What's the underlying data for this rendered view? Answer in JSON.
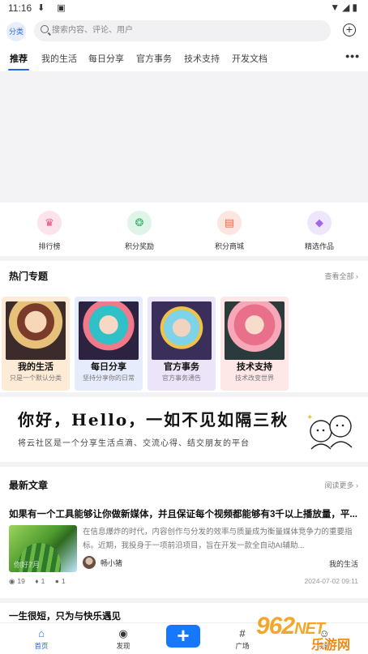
{
  "status_bar": {
    "time": "11:16",
    "left_icons": "⬇ ▣",
    "right_icons": "▼◢▮"
  },
  "header": {
    "category_label": "分类",
    "search_placeholder": "搜索内容、评论、用户"
  },
  "tabs": [
    "推荐",
    "我的生活",
    "每日分享",
    "官方事务",
    "技术支持",
    "开发文档"
  ],
  "more_label": "•••",
  "quick_links": [
    {
      "label": "排行榜",
      "icon": "crown-icon",
      "glyph": "♛",
      "bg": "#fde3ec",
      "fg": "#e94f86"
    },
    {
      "label": "积分奖励",
      "icon": "coin-icon",
      "glyph": "❂",
      "bg": "#dff5e8",
      "fg": "#34b26b"
    },
    {
      "label": "积分商城",
      "icon": "shop-icon",
      "glyph": "▤",
      "bg": "#fde6e2",
      "fg": "#ee6a56"
    },
    {
      "label": "精选作品",
      "icon": "gem-icon",
      "glyph": "◆",
      "bg": "#efe6fb",
      "fg": "#a368e8"
    }
  ],
  "topics": {
    "title": "热门专题",
    "more": "查看全部 ›",
    "items": [
      {
        "name": "我的生活",
        "desc": "只是一个默认分类",
        "bg": "#fdebd6"
      },
      {
        "name": "每日分享",
        "desc": "坚持分享你的日常",
        "bg": "#e6ecfb"
      },
      {
        "name": "官方事务",
        "desc": "官方事务通告",
        "bg": "#ece5f9"
      },
      {
        "name": "技术支持",
        "desc": "技术改变世界",
        "bg": "#fde7e7"
      }
    ]
  },
  "slogan": {
    "headline": "你好，Hello，一如不见如隔三秋",
    "subline": "将云社区是一个分享生活点滴、交流心得、结交朋友的平台"
  },
  "latest": {
    "title": "最新文章",
    "more": "阅读更多 ›",
    "article": {
      "title": "如果有一个工具能够让你做新媒体，并且保证每个视频都能够有3千以上播放量，平...",
      "summary": "在信息爆炸的时代，内容创作与分发的效率与质量成为衡量媒体竞争力的重要指标。近期，我投身于一项前沿项目，旨在开发一款全自动AI辅助...",
      "thumb_text": "你好7月",
      "author": "畅小猪",
      "category": "我的生活",
      "views": "19",
      "likes": "1",
      "comments": "1",
      "date": "2024-07-02 09:11"
    },
    "next_title": "一生很短，只为与快乐遇见"
  },
  "bottom_nav": [
    {
      "label": "首页",
      "icon": "home-icon",
      "glyph": "⌂"
    },
    {
      "label": "发现",
      "icon": "compass-icon",
      "glyph": "◉"
    },
    {
      "label": "",
      "icon": "add-icon",
      "glyph": "+"
    },
    {
      "label": "广场",
      "icon": "hashtag-icon",
      "glyph": "#"
    },
    {
      "label": "我的",
      "icon": "user-icon",
      "glyph": "☺"
    }
  ],
  "watermark": {
    "brand": "962",
    "suffix": "NET",
    "sub": "乐游网"
  },
  "colors": {
    "accent": "#2563eb",
    "fab": "#1677ff"
  }
}
